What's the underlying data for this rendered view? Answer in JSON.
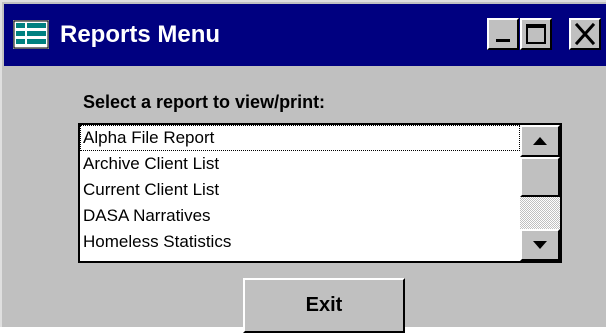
{
  "window": {
    "title": "Reports Menu",
    "icon": "reports-app-icon",
    "controls": {
      "minimize_icon": "minimize-icon",
      "maximize_icon": "maximize-icon",
      "close_icon": "close-icon"
    }
  },
  "dialog": {
    "prompt": "Select a report to view/print:",
    "reports": [
      "Alpha File Report",
      "Archive Client List",
      "Current Client List",
      "DASA Narratives",
      "Homeless Statistics"
    ],
    "focused_item": "Alpha File Report",
    "scrollbar": {
      "up_icon": "scroll-up-arrow-icon",
      "down_icon": "scroll-down-arrow-icon"
    },
    "exit_label": "Exit"
  },
  "colors": {
    "titlebar": "#000080",
    "face": "#c0c0c0",
    "list_bg": "#ffffff"
  }
}
